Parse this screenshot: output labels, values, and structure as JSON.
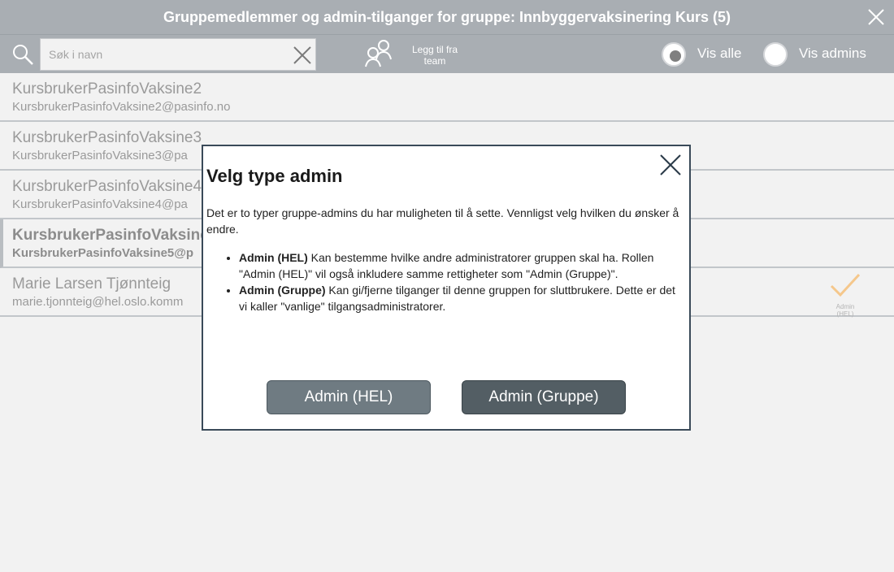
{
  "window": {
    "title": "Gruppemedlemmer og admin-tilganger for gruppe: Innbyggervaksinering Kurs (5)"
  },
  "toolbar": {
    "search_placeholder": "Søk i navn",
    "add_team_label": "Legg til fra team",
    "radio_all_label": "Vis alle",
    "radio_admins_label": "Vis admins",
    "selected_filter": "Vis alle"
  },
  "members": [
    {
      "name": "KursbrukerPasinfoVaksine2",
      "email": "KursbrukerPasinfoVaksine2@pasinfo.no"
    },
    {
      "name": "KursbrukerPasinfoVaksine3",
      "email": "KursbrukerPasinfoVaksine3@pa"
    },
    {
      "name": "KursbrukerPasinfoVaksine4",
      "email": "KursbrukerPasinfoVaksine4@pa"
    },
    {
      "name": "KursbrukerPasinfoVaksine",
      "email": "KursbrukerPasinfoVaksine5@p"
    },
    {
      "name": "Marie Larsen Tjønnteig",
      "email": "marie.tjonnteig@hel.oslo.komm",
      "badge": "Admin (HEL)"
    }
  ],
  "modal": {
    "title": "Velg type admin",
    "intro": "Det er to typer gruppe-admins du har muligheten til å sette. Vennligst velg hvilken du ønsker å endre.",
    "items": [
      {
        "term": "Admin (HEL)",
        "text": " Kan bestemme hvilke andre administratorer gruppen skal ha. Rollen \"Admin (HEL)\" vil også inkludere samme rettigheter som \"Admin (Gruppe)\"."
      },
      {
        "term": "Admin (Gruppe)",
        "text": " Kan gi/fjerne tilganger til denne gruppen for sluttbrukere. Dette er det vi kaller \"vanlige\" tilgangsadministratorer."
      }
    ],
    "btn_hel": "Admin (HEL)",
    "btn_gruppe": "Admin (Gruppe)"
  },
  "colors": {
    "header_bg": "#a9aeb3",
    "background": "#f2f2f2",
    "modal_border": "#3a4a59",
    "btn_hel": "#6f7b82",
    "btn_gruppe": "#535e64",
    "check": "#f5c78b"
  },
  "icons": {
    "window_close": "close-icon",
    "search": "search-icon",
    "clear": "clear-icon",
    "add_team": "people-add-icon",
    "admin_check": "checkmark-icon"
  }
}
